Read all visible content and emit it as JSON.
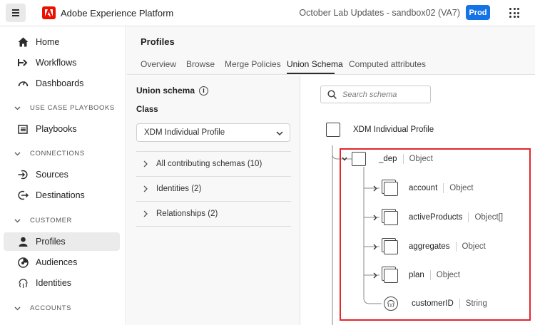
{
  "app": {
    "title": "Adobe Experience Platform",
    "org": "October Lab Updates - sandbox02 (VA7)",
    "env_badge": "Prod"
  },
  "sidebar": {
    "items": [
      {
        "label": "Home",
        "icon": "home-icon"
      },
      {
        "label": "Workflows",
        "icon": "workflows-icon"
      },
      {
        "label": "Dashboards",
        "icon": "dashboard-icon"
      }
    ],
    "sections": [
      {
        "label": "USE CASE PLAYBOOKS",
        "items": [
          {
            "label": "Playbooks",
            "icon": "playbooks-icon"
          }
        ]
      },
      {
        "label": "CONNECTIONS",
        "items": [
          {
            "label": "Sources",
            "icon": "sources-icon"
          },
          {
            "label": "Destinations",
            "icon": "destinations-icon"
          }
        ]
      },
      {
        "label": "CUSTOMER",
        "items": [
          {
            "label": "Profiles",
            "icon": "profile-icon",
            "active": true
          },
          {
            "label": "Audiences",
            "icon": "audiences-icon"
          },
          {
            "label": "Identities",
            "icon": "fingerprint-icon"
          }
        ]
      },
      {
        "label": "ACCOUNTS",
        "items": []
      }
    ]
  },
  "page": {
    "title": "Profiles",
    "tabs": [
      "Overview",
      "Browse",
      "Merge Policies",
      "Union Schema",
      "Computed attributes"
    ],
    "active_tab": "Union Schema"
  },
  "left_panel": {
    "title": "Union schema",
    "class_label": "Class",
    "class_value": "XDM Individual Profile",
    "accordions": [
      "All contributing schemas (10)",
      "Identities (2)",
      "Relationships (2)"
    ]
  },
  "schema_tree": {
    "search_placeholder": "Search schema",
    "root": "XDM Individual Profile",
    "group": {
      "name": "_dep",
      "type": "Object"
    },
    "children": [
      {
        "name": "account",
        "type": "Object"
      },
      {
        "name": "activeProducts",
        "type": "Object[]"
      },
      {
        "name": "aggregates",
        "type": "Object"
      },
      {
        "name": "plan",
        "type": "Object"
      },
      {
        "name": "customerID",
        "type": "String"
      }
    ]
  },
  "colors": {
    "accent": "#1473e6",
    "adobe_red": "#eb1000",
    "highlight": "#e3262b"
  }
}
